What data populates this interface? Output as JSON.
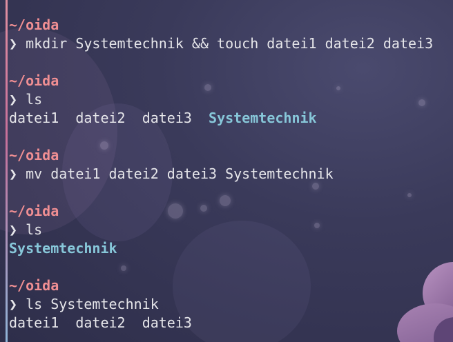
{
  "terminal": {
    "prompt_symbol": "❯",
    "blocks": [
      {
        "path": "~/oida",
        "command": "mkdir Systemtechnik && touch datei1 datei2 datei3",
        "output": []
      },
      {
        "path": "~/oida",
        "command": "ls",
        "output": [
          {
            "text": "datei1",
            "type": "file"
          },
          {
            "text": "datei2",
            "type": "file"
          },
          {
            "text": "datei3",
            "type": "file"
          },
          {
            "text": "Systemtechnik",
            "type": "dir"
          }
        ]
      },
      {
        "path": "~/oida",
        "command": "mv datei1 datei2 datei3 Systemtechnik",
        "output": []
      },
      {
        "path": "~/oida",
        "command": "ls",
        "output": [
          {
            "text": "Systemtechnik",
            "type": "dir"
          }
        ]
      },
      {
        "path": "~/oida",
        "command": "ls Systemtechnik",
        "output": [
          {
            "text": "datei1",
            "type": "file"
          },
          {
            "text": "datei2",
            "type": "file"
          },
          {
            "text": "datei3",
            "type": "file"
          }
        ]
      }
    ]
  },
  "colors": {
    "path": "#f08f93",
    "directory": "#87c7d9",
    "text": "#e6e6ea"
  }
}
